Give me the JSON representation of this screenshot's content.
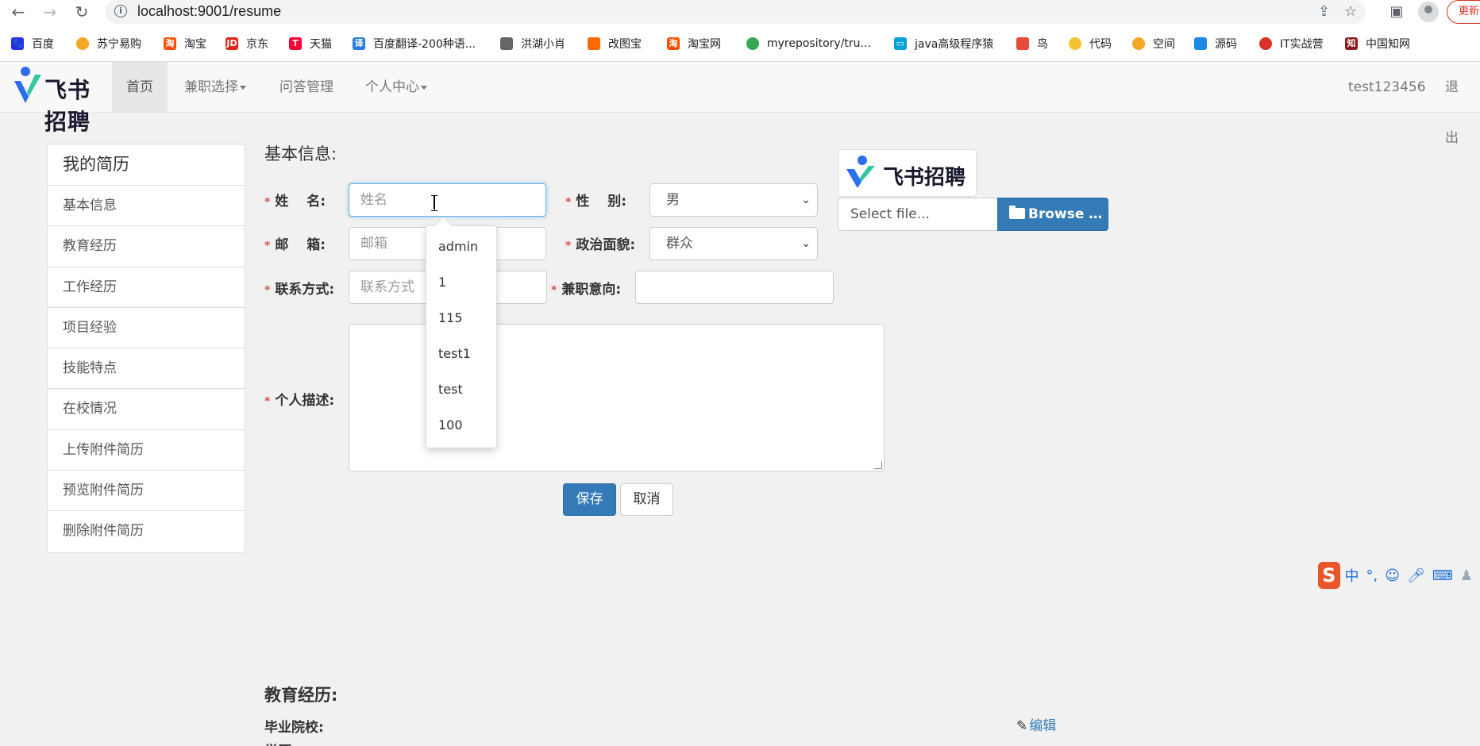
{
  "browser": {
    "url": "localhost:9001/resume",
    "update_label": "更新"
  },
  "bookmarks": [
    {
      "label": "百度",
      "color": "#2932e1"
    },
    {
      "label": "苏宁易购",
      "color": "#f5a623"
    },
    {
      "label": "淘宝",
      "color": "#ff5000"
    },
    {
      "label": "京东",
      "color": "#e1251b"
    },
    {
      "label": "天猫",
      "color": "#ff0036"
    },
    {
      "label": "百度翻译-200种语...",
      "color": "#2a7ae2"
    },
    {
      "label": "洪湖小肖",
      "color": "#666666"
    },
    {
      "label": "改图宝",
      "color": "#ff6a00"
    },
    {
      "label": "淘宝网",
      "color": "#ff5000"
    },
    {
      "label": "myrepository/tru...",
      "color": "#34a853"
    },
    {
      "label": "java高级程序猿",
      "color": "#00a1d6"
    },
    {
      "label": "鸟",
      "color": "#e84a3c"
    },
    {
      "label": "代码",
      "color": "#f4c430"
    },
    {
      "label": "空间",
      "color": "#f5a623"
    },
    {
      "label": "源码",
      "color": "#1e88e5"
    },
    {
      "label": "IT实战营",
      "color": "#d93025"
    },
    {
      "label": "中国知网",
      "color": "#8b1a1a"
    }
  ],
  "navbar": {
    "brand": "飞书招聘",
    "items": [
      {
        "label": "首页",
        "dropdown": false
      },
      {
        "label": "兼职选择",
        "dropdown": true
      },
      {
        "label": "问答管理",
        "dropdown": false
      },
      {
        "label": "个人中心",
        "dropdown": true
      }
    ],
    "username": "test123456",
    "logout": "退出"
  },
  "sidebar": {
    "title": "我的简历",
    "items": [
      "基本信息",
      "教育经历",
      "工作经历",
      "项目经验",
      "技能特点",
      "在校情况",
      "上传附件简历",
      "预览附件简历",
      "删除附件简历"
    ]
  },
  "basic_info": {
    "title": "基本信息:",
    "name_label": "姓　 名:",
    "name_placeholder": "姓名",
    "gender_label": "性　 别:",
    "gender_value": "男",
    "email_label": "邮　 箱:",
    "email_placeholder": "邮箱",
    "political_label": "政治面貌:",
    "political_value": "群众",
    "contact_label": "联系方式:",
    "contact_placeholder": "联系方式",
    "intent_label": "兼职意向:",
    "desc_label": "个人描述:",
    "save": "保存",
    "cancel": "取消"
  },
  "autocomplete": [
    "admin",
    "1",
    "115",
    "test1",
    "test",
    "100"
  ],
  "upload": {
    "brand": "飞书招聘",
    "file_placeholder": "Select file...",
    "browse": "Browse …"
  },
  "education": {
    "title": "教育经历:",
    "school_label": "毕业院校:",
    "degree_label": "学历:",
    "edit": "编辑"
  },
  "ime": {
    "logo": "S",
    "mode": "中",
    "punct": "°,"
  }
}
